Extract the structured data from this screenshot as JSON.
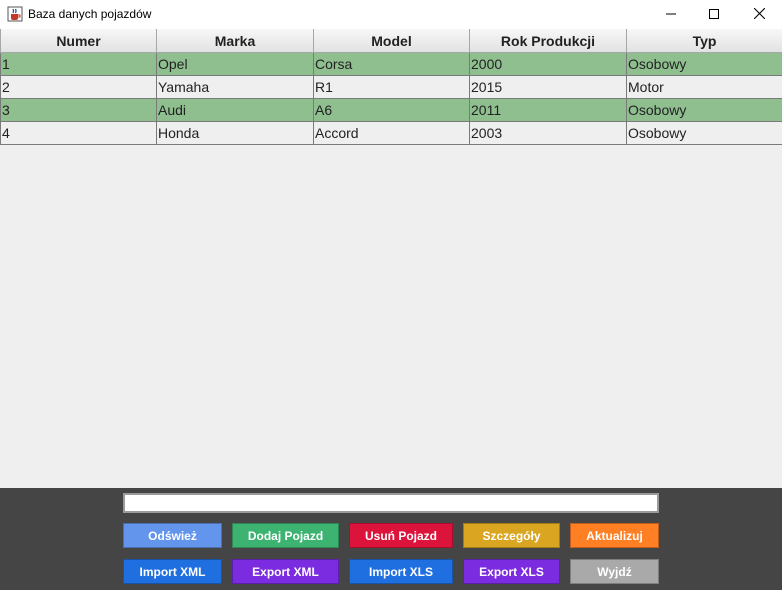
{
  "window": {
    "title": "Baza danych pojazdów",
    "icon": "java-coffee-cup-icon",
    "controls": [
      "minimize-icon",
      "maximize-icon",
      "close-icon"
    ]
  },
  "table": {
    "columns": [
      "Numer",
      "Marka",
      "Model",
      "Rok Produkcji",
      "Typ"
    ],
    "rows": [
      [
        "1",
        "Opel",
        "Corsa",
        "2000",
        "Osobowy"
      ],
      [
        "2",
        "Yamaha",
        "R1",
        "2015",
        "Motor"
      ],
      [
        "3",
        "Audi",
        "A6",
        "2011",
        "Osobowy"
      ],
      [
        "4",
        "Honda",
        "Accord",
        "2003",
        "Osobowy"
      ]
    ],
    "row_colors": {
      "alternate": "#8fbf8f",
      "normal": "#efefef"
    }
  },
  "search": {
    "value": "",
    "placeholder": ""
  },
  "buttons": {
    "refresh": "Odśwież",
    "add": "Dodaj Pojazd",
    "remove": "Usuń Pojazd",
    "details": "Szczegóły",
    "update": "Aktualizuj",
    "import_xml": "Import XML",
    "export_xml": "Export XML",
    "import_xls": "Import XLS",
    "export_xls": "Export XLS",
    "exit": "Wyjdź"
  },
  "colors": {
    "refresh": "#6495ed",
    "add": "#3cb371",
    "remove": "#dc143c",
    "details": "#daa520",
    "update": "#ff7f24",
    "import": "#1f6fe0",
    "export": "#7b2be0",
    "exit": "#a9a9a9",
    "panel": "#454545"
  }
}
